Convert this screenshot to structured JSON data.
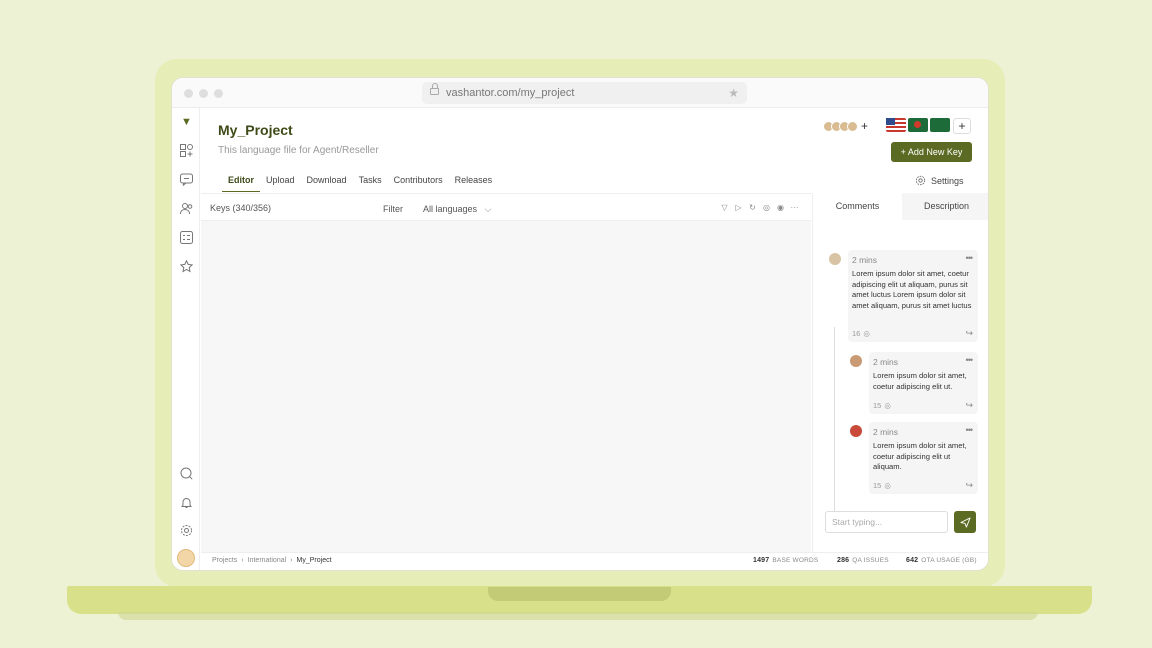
{
  "browser": {
    "url": "vashantor.com/my_project"
  },
  "project": {
    "title": "My_Project",
    "subtitle": "This language file for Agent/Reseller",
    "add_key_label": "+ Add New Key",
    "flags": [
      "us-flag",
      "bd-flag",
      "sa-flag"
    ],
    "add_language": "+"
  },
  "tabs": [
    "Editor",
    "Upload",
    "Download",
    "Tasks",
    "Contributors",
    "Releases"
  ],
  "settings_label": "Settings",
  "toolbar": {
    "keys_count": "Keys (340/356)",
    "filter_label": "Filter",
    "language_select": "All languages"
  },
  "panel": {
    "tabs": [
      "Comments",
      "Description"
    ],
    "comments": [
      {
        "time": "2 mins",
        "text": "Lorem ipsum dolor sit amet, coetur adipiscing elit ut aliquam, purus sit amet luctus Lorem ipsum dolor sit amet aliquam, purus sit amet luctus",
        "views": "16"
      },
      {
        "time": "2 mins",
        "text": "Lorem ipsum dolor sit amet, coetur adipiscing elit ut.",
        "views": "15"
      },
      {
        "time": "2 mins",
        "text": "Lorem ipsum dolor sit amet, coetur adipiscing elit ut aliquam.",
        "views": "15"
      }
    ],
    "compose_placeholder": "Start typing..."
  },
  "breadcrumbs": [
    "Projects",
    "International",
    "My_Project"
  ],
  "stats": [
    {
      "value": "1497",
      "label": "BASE WORDS"
    },
    {
      "value": "286",
      "label": "QA ISSUES"
    },
    {
      "value": "642",
      "label": "OTA USAGE (GB)"
    }
  ],
  "colors": {
    "accent": "#5b6b24",
    "background": "#eef2d4",
    "laptop": "#e7edb6"
  }
}
